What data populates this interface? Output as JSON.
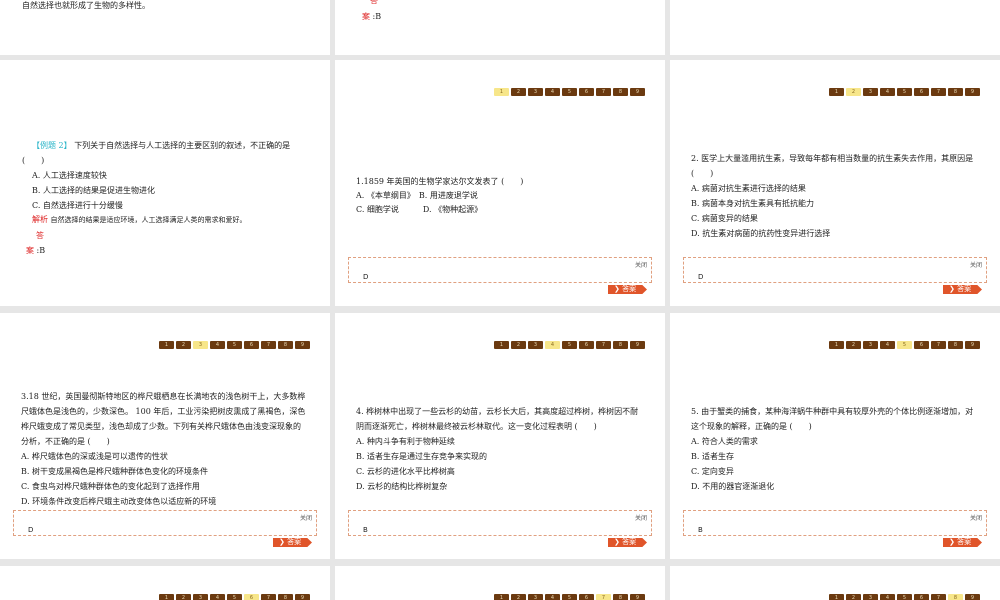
{
  "row0": {
    "left_text": "自然选择也就形成了生物的多样性。",
    "answer_char1": "答",
    "answer_char2": "案",
    "answer_value": " :B"
  },
  "example": {
    "tag": "【例题 2】",
    "stem": "下列关于自然选择与人工选择的主要区别的叙述，不正确的是",
    "paren": "(　　)",
    "options": [
      "A. 人工选择速度较快",
      "B. 人工选择的结果是促进生物进化",
      "C. 自然选择进行十分缓慢"
    ],
    "analysis_label": "解析",
    "analysis_text": "自然选择的结果是适应环境，人工选择满足人类的需求和爱好。",
    "answer_char1": "答",
    "answer_char2": "案",
    "answer_value": " :B"
  },
  "nav_labels": [
    "1",
    "2",
    "3",
    "4",
    "5",
    "6",
    "7",
    "8",
    "9"
  ],
  "close_label": "关闭",
  "answer_button": "答案",
  "questions": [
    {
      "lines": [
        "1.1859 年英国的生物学家达尔文发表了 (　　)"
      ],
      "options": [
        "A. 《本草纲目》　B. 用进废退学说",
        "C. 细胞学说　　　D. 《物种起源》"
      ],
      "answer": "D",
      "current": 1
    },
    {
      "lines": [
        "2. 医学上大量滥用抗生素，导致每年都有相当数量的抗生素失去作用，其原因是",
        "(　　)"
      ],
      "options": [
        "A. 病菌对抗生素进行选择的结果",
        "B. 病菌本身对抗生素具有抵抗能力",
        "C. 病菌变异的结果",
        "D. 抗生素对病菌的抗药性变异进行选择"
      ],
      "answer": "D",
      "current": 2
    },
    {
      "lines": [
        "3.18 世纪，英国曼彻斯特地区的桦尺蛾栖息在长满地衣的浅色树干上，大多数桦",
        "尺蛾体色是浅色的，少数深色。 100 年后，工业污染把树皮熏成了黑褐色，深色",
        "桦尺蛾变成了常见类型，浅色却成了少数。下列有关桦尺蛾体色由浅变深现象的",
        "分析，不正确的是 (　　)"
      ],
      "options": [
        "A. 桦尺蛾体色的深或浅是可以遗传的性状",
        "B. 树干变成黑褐色是桦尺蛾种群体色变化的环境条件",
        "C. 食虫鸟对桦尺蛾种群体色的变化起到了选择作用",
        "D. 环境条件改变后桦尺蛾主动改变体色以适应新的环境"
      ],
      "answer": "D",
      "current": 3
    },
    {
      "lines": [
        "4. 桦树林中出现了一些云杉的幼苗，云杉长大后，其高度超过桦树，桦树因不耐",
        "阴而逐渐死亡，桦树林最终被云杉林取代。这一变化过程表明 (　　)"
      ],
      "options": [
        "A. 种内斗争有利于物种延续",
        "B. 适者生存是通过生存竞争来实现的",
        "C. 云杉的进化水平比桦树高",
        "D. 云杉的结构比桦树复杂"
      ],
      "answer": "B",
      "current": 4
    },
    {
      "lines": [
        "5. 由于蟹类的捕食，某种海洋蜗牛种群中具有较厚外壳的个体比例逐渐增加，对",
        "这个现象的解释，正确的是 (　　)"
      ],
      "options": [
        "A. 符合人类的需求",
        "B. 适者生存",
        "C. 定向变异",
        "D. 不用的器官逐渐退化"
      ],
      "answer": "B",
      "current": 5
    }
  ],
  "bottom_current": [
    6,
    7,
    8
  ]
}
